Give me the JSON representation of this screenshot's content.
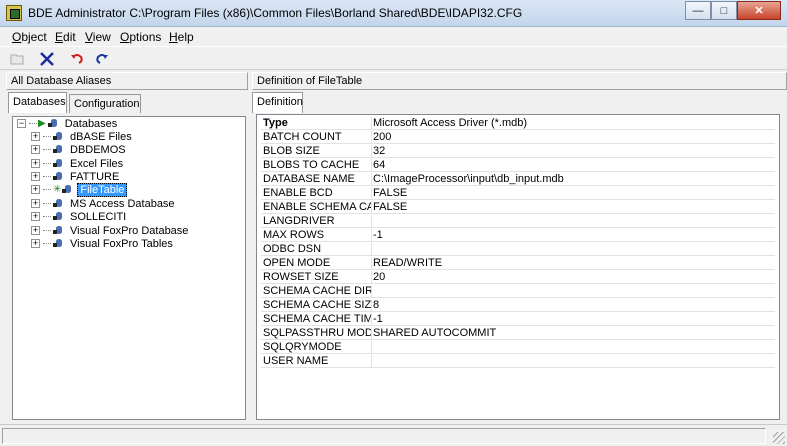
{
  "window": {
    "title": "BDE Administrator  C:\\Program Files (x86)\\Common Files\\Borland Shared\\BDE\\IDAPI32.CFG",
    "minimize_glyph": "—",
    "maximize_glyph": "□",
    "close_glyph": "✕"
  },
  "menu": [
    "Object",
    "Edit",
    "View",
    "Options",
    "Help"
  ],
  "toolbar": {
    "icons": [
      "open-icon",
      "delete-icon",
      "undo-icon",
      "redo-icon"
    ],
    "delete_color": "#1a2a9a",
    "undo_color": "#cc2020",
    "redo_color": "#1a3a9a"
  },
  "left": {
    "header": "All Database Aliases",
    "tabs": [
      "Databases",
      "Configuration"
    ],
    "root": "Databases",
    "items": [
      "dBASE Files",
      "DBDEMOS",
      "Excel Files",
      "FATTURE",
      "FileTable",
      "MS Access Database",
      "SOLLECITI",
      "Visual FoxPro Database",
      "Visual FoxPro Tables"
    ],
    "selected": "FileTable"
  },
  "right": {
    "header": "Definition of FileTable",
    "tab": "Definition",
    "rows": [
      {
        "key": "Type",
        "value": "Microsoft Access Driver (*.mdb)"
      },
      {
        "key": "BATCH COUNT",
        "value": "200"
      },
      {
        "key": "BLOB SIZE",
        "value": "32"
      },
      {
        "key": "BLOBS TO CACHE",
        "value": "64"
      },
      {
        "key": "DATABASE NAME",
        "value": "C:\\ImageProcessor\\input\\db_input.mdb"
      },
      {
        "key": "ENABLE BCD",
        "value": "FALSE"
      },
      {
        "key": "ENABLE SCHEMA CACHE",
        "value": "FALSE"
      },
      {
        "key": "LANGDRIVER",
        "value": ""
      },
      {
        "key": "MAX ROWS",
        "value": "-1"
      },
      {
        "key": "ODBC DSN",
        "value": ""
      },
      {
        "key": "OPEN MODE",
        "value": "READ/WRITE"
      },
      {
        "key": "ROWSET SIZE",
        "value": "20"
      },
      {
        "key": "SCHEMA CACHE DIR",
        "value": ""
      },
      {
        "key": "SCHEMA CACHE SIZE",
        "value": "8"
      },
      {
        "key": "SCHEMA CACHE TIME",
        "value": "-1"
      },
      {
        "key": "SQLPASSTHRU MODE",
        "value": "SHARED AUTOCOMMIT"
      },
      {
        "key": "SQLQRYMODE",
        "value": ""
      },
      {
        "key": "USER NAME",
        "value": ""
      }
    ]
  },
  "colors": {
    "selection": "#3399ff",
    "grid_line": "#e2e2e2"
  }
}
